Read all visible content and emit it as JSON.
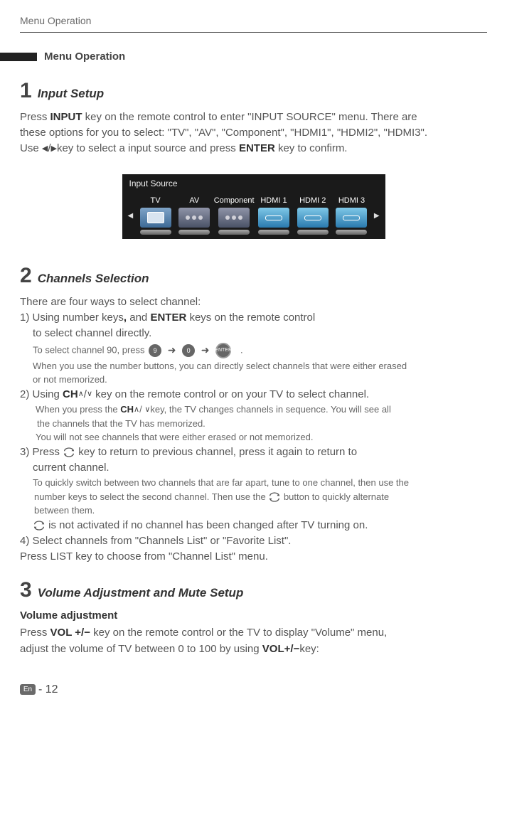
{
  "header": {
    "title": "Menu Operation"
  },
  "sectionTitle": "Menu Operation",
  "section1": {
    "num": "1",
    "title": "Input Setup",
    "p1a": "Press ",
    "p1b": "INPUT",
    "p1c": " key on the remote control to enter \"INPUT SOURCE\" menu. There are",
    "p2": "these options for you to select:  \"TV\",  \"AV\",  \"Component\", \"HDMI1\", \"HDMI2\",  \"HDMI3\".",
    "p3a": "Use ",
    "p3b": "key to select a input source and press ",
    "p3c": "ENTER",
    "p3d": " key to confirm."
  },
  "inputSource": {
    "title": "Input Source",
    "items": [
      {
        "label": "TV"
      },
      {
        "label": "AV"
      },
      {
        "label": "Component"
      },
      {
        "label": "HDMI 1"
      },
      {
        "label": "HDMI 2"
      },
      {
        "label": "HDMI 3"
      }
    ]
  },
  "section2": {
    "num": "2",
    "title": "Channels Selection",
    "intro": "There are four ways to select channel:",
    "m1a": "1) Using number keys",
    "m1comma": ",",
    "m1b": " and ",
    "m1c": "ENTER",
    "m1d": " keys on the remote control",
    "m1line2": "to select channel directly.",
    "m1note1": "To select channel 90, press",
    "m1note1end": ".",
    "m1note2": "When you use the number buttons, you can directly select channels that were either erased",
    "m1note3": "or not memorized.",
    "m2a": "2) Using ",
    "m2b": "CH",
    "m2c": " key on the remote control or on your TV to select channel.",
    "m2note1a": "When you press the ",
    "m2note1b": "CH",
    "m2note1c": "key, the TV changes channels in sequence. You will see all",
    "m2note2": "the channels that the TV has memorized.",
    "m2note3": "You will not see channels that were either erased or not memorized.",
    "m3a": "3) Press ",
    "m3b": " key to return to previous channel, press it again to return to",
    "m3line2": "current channel.",
    "m3note1": "To quickly switch between two channels that are far apart, tune to one channel, then use the",
    "m3note2a": "number keys to select the second channel. Then use the ",
    "m3note2b": " button to quickly alternate",
    "m3note3": "between them.",
    "m3final": " is not activated if no channel has been changed after TV turning on.",
    "m4": "4) Select channels from \"Channels List\" or \"Favorite List\".",
    "m4b": "Press LIST key to choose from \"Channel List\" menu."
  },
  "section3": {
    "num": "3",
    "title": "Volume Adjustment and Mute Setup",
    "sub": "Volume adjustment",
    "p1a": "Press ",
    "p1b": "VOL",
    "p1c": " key on the remote control or the TV to display \"Volume\" menu,",
    "p2a": "adjust the volume of TV between 0 to 100 by using ",
    "p2b": "VOL",
    "p2c": "key:"
  },
  "footer": {
    "lang": "En",
    "page": "- 12"
  },
  "keys": {
    "nine": "9",
    "zero": "0",
    "enter": "ENTER"
  }
}
